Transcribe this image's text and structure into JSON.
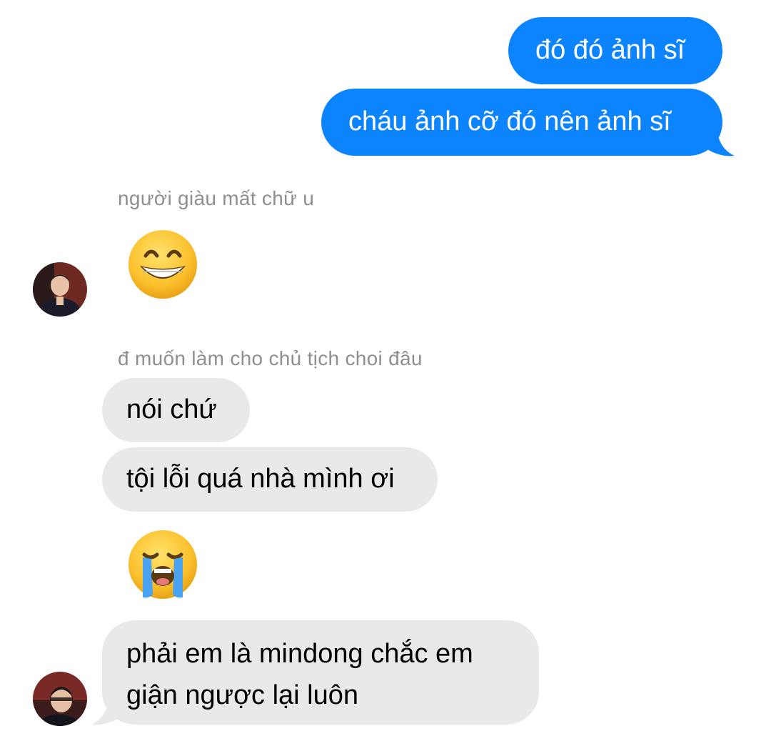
{
  "messages": {
    "sent_1": "đó đó ảnh sĩ",
    "sent_2": "cháu ảnh cỡ đó nên ảnh sĩ",
    "reply_label_1": "người giàu mất chữ u",
    "emoji_1": "grinning-face-with-smiling-eyes",
    "reply_label_2": "đ muốn làm cho chủ tịch choi đâu",
    "received_1": "nói chứ",
    "received_2": "tội lỗi quá nhà mình ơi",
    "emoji_2": "loudly-crying-face",
    "received_3_line1": "phải em là mindong chắc em",
    "received_3_line2": "giận ngược lại luôn"
  },
  "colors": {
    "sent_bubble": "#0b84fe",
    "received_bubble": "#e9e9eb",
    "reply_label": "#8e8e93"
  }
}
